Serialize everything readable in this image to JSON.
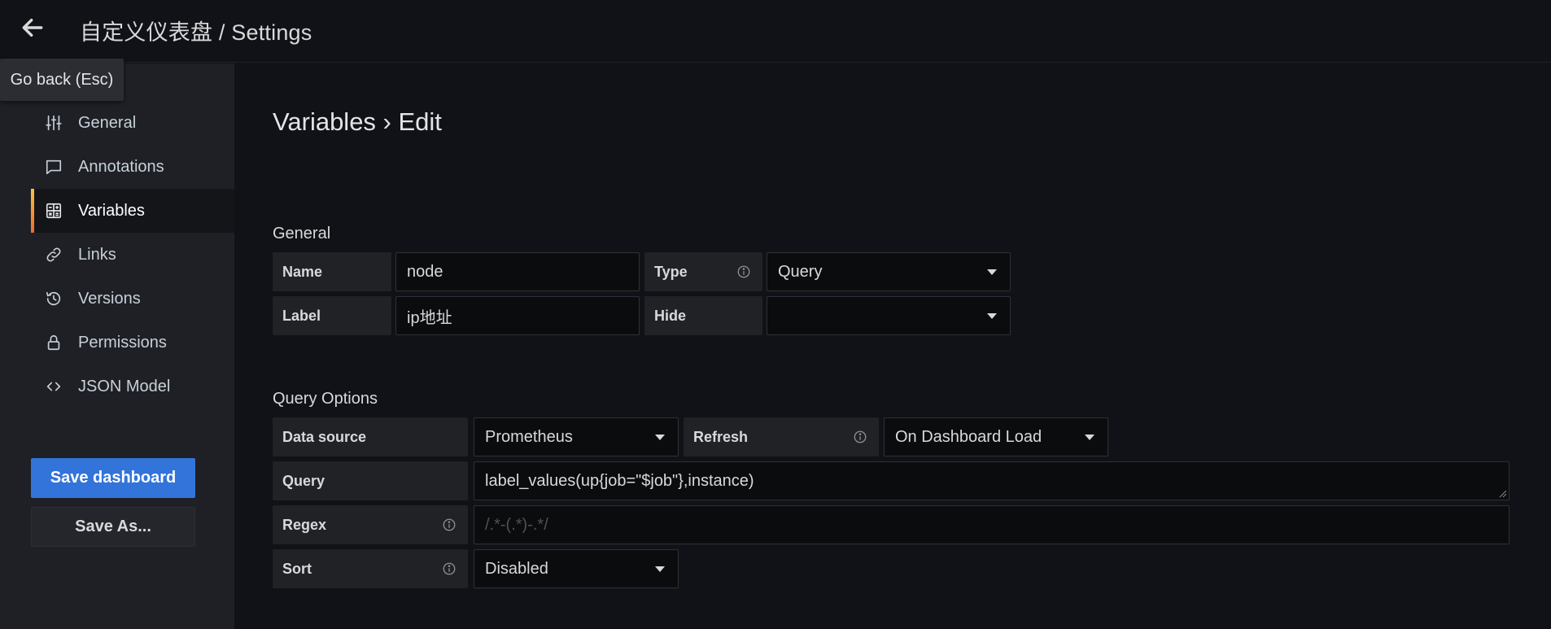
{
  "header": {
    "title": "自定义仪表盘 / Settings",
    "tooltip": "Go back (Esc)"
  },
  "sidebar": {
    "items": [
      {
        "label": "General",
        "icon": "sliders-icon"
      },
      {
        "label": "Annotations",
        "icon": "comment-icon"
      },
      {
        "label": "Variables",
        "icon": "calculator-icon",
        "active": true
      },
      {
        "label": "Links",
        "icon": "link-icon"
      },
      {
        "label": "Versions",
        "icon": "history-icon"
      },
      {
        "label": "Permissions",
        "icon": "lock-icon"
      },
      {
        "label": "JSON Model",
        "icon": "code-icon"
      }
    ],
    "save_label": "Save dashboard",
    "save_as_label": "Save As..."
  },
  "main": {
    "title": "Variables › Edit",
    "general": {
      "section_title": "General",
      "name_label": "Name",
      "name_value": "node",
      "type_label": "Type",
      "type_value": "Query",
      "label_label": "Label",
      "label_value": "ip地址",
      "hide_label": "Hide",
      "hide_value": ""
    },
    "query_options": {
      "section_title": "Query Options",
      "datasource_label": "Data source",
      "datasource_value": "Prometheus",
      "refresh_label": "Refresh",
      "refresh_value": "On Dashboard Load",
      "query_label": "Query",
      "query_value": "label_values(up{job=\"$job\"},instance)",
      "regex_label": "Regex",
      "regex_placeholder": "/.*-(.*)-.*/",
      "sort_label": "Sort",
      "sort_value": "Disabled"
    }
  },
  "colors": {
    "primary": "#3274d9",
    "active_accent_start": "#f6c244",
    "active_accent_end": "#ef6a32",
    "background": "#111217",
    "sidebar": "#1f2025"
  }
}
